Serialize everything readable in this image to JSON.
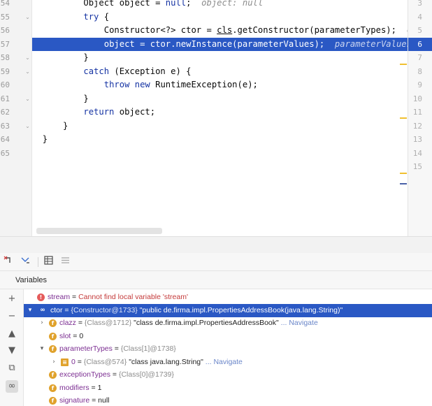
{
  "editor": {
    "gutter_lines": [
      "54",
      "55",
      "56",
      "57",
      "58",
      "59",
      "60",
      "61",
      "62",
      "63",
      "64",
      "65"
    ],
    "code_lines": [
      {
        "indent": "        ",
        "parts": [
          {
            "t": "Object object = "
          },
          {
            "t": "null",
            "c": "kw"
          },
          {
            "t": ";  "
          },
          {
            "t": "object: null",
            "c": "hint"
          }
        ]
      },
      {
        "indent": "        ",
        "parts": [
          {
            "t": "try",
            "c": "kw"
          },
          {
            "t": " {"
          }
        ]
      },
      {
        "indent": "            ",
        "parts": [
          {
            "t": "Constructor<?> ctor = "
          },
          {
            "t": "cls",
            "c": "ul"
          },
          {
            "t": ".getConstructor(parameterTypes);  "
          },
          {
            "t": "cls: \"clas",
            "c": "hint"
          }
        ]
      },
      {
        "indent": "            ",
        "exec": true,
        "parts": [
          {
            "t": "object = ctor.newInstance(parameterValues);  "
          },
          {
            "t": "parameterValues: Object[",
            "c": "hint"
          }
        ]
      },
      {
        "indent": "        ",
        "parts": [
          {
            "t": "}"
          }
        ]
      },
      {
        "indent": "        ",
        "parts": [
          {
            "t": "catch",
            "c": "kw"
          },
          {
            "t": " (Exception e) {"
          }
        ]
      },
      {
        "indent": "            ",
        "parts": [
          {
            "t": "throw new",
            "c": "kw"
          },
          {
            "t": " RuntimeException(e);"
          }
        ]
      },
      {
        "indent": "        ",
        "parts": [
          {
            "t": "}"
          }
        ]
      },
      {
        "indent": "        ",
        "parts": [
          {
            "t": "return",
            "c": "kw"
          },
          {
            "t": " object;"
          }
        ]
      },
      {
        "indent": "    ",
        "parts": [
          {
            "t": "}"
          }
        ]
      },
      {
        "indent": "",
        "parts": [
          {
            "t": "}"
          }
        ]
      },
      {
        "indent": "",
        "parts": []
      }
    ],
    "side_numbers": [
      "3",
      "4",
      "5",
      "6",
      "7",
      "8",
      "9",
      "10",
      "11",
      "12",
      "13",
      "14",
      "15"
    ],
    "marker_colors": {
      "warning": "#f0c030",
      "info": "#4a62a8"
    }
  },
  "toolbar": {
    "buttons": [
      "restore-layout-icon",
      "step-icon",
      "table-icon",
      "grid-icon"
    ]
  },
  "variables": {
    "title": "Variables",
    "sidebar_buttons": [
      "+",
      "−",
      "▲",
      "▼",
      "⧉",
      "∞"
    ],
    "rows": [
      {
        "depth": 0,
        "chev": "",
        "icon": "error",
        "name": "stream",
        "eq": " = ",
        "value": "Cannot find local variable 'stream'",
        "value_class": "err"
      },
      {
        "depth": 0,
        "chev": "▾",
        "icon": "oo",
        "name": "ctor",
        "eq": " = ",
        "ref": "{Constructor@1733} ",
        "value": "\"public de.firma.impl.PropertiesAddressBook(java.lang.String)\"",
        "selected": true
      },
      {
        "depth": 1,
        "chev": "›",
        "icon": "field",
        "name": "clazz",
        "eq": " = ",
        "ref": "{Class@1712} ",
        "value": "\"class de.firma.impl.PropertiesAddressBook\"",
        "nav": " ... Navigate"
      },
      {
        "depth": 1,
        "chev": "",
        "icon": "field",
        "name": "slot",
        "eq": " = ",
        "value": "0"
      },
      {
        "depth": 1,
        "chev": "▾",
        "icon": "field",
        "name": "parameterTypes",
        "eq": " = ",
        "ref": "{Class[1]@1738}"
      },
      {
        "depth": 2,
        "chev": "›",
        "icon": "array",
        "name": "0",
        "eq": " = ",
        "ref": "{Class@574} ",
        "value": "\"class java.lang.String\"",
        "nav": " ... Navigate"
      },
      {
        "depth": 1,
        "chev": "",
        "icon": "field",
        "name": "exceptionTypes",
        "eq": " = ",
        "ref": "{Class[0]@1739}"
      },
      {
        "depth": 1,
        "chev": "",
        "icon": "field",
        "name": "modifiers",
        "eq": " = ",
        "value": "1"
      },
      {
        "depth": 1,
        "chev": "",
        "icon": "field",
        "name": "signature",
        "eq": " = ",
        "value": "null"
      }
    ]
  },
  "colors": {
    "accent": "#2a58c4",
    "field_icon": "#e0a22c",
    "error_icon": "#e55b5b"
  }
}
